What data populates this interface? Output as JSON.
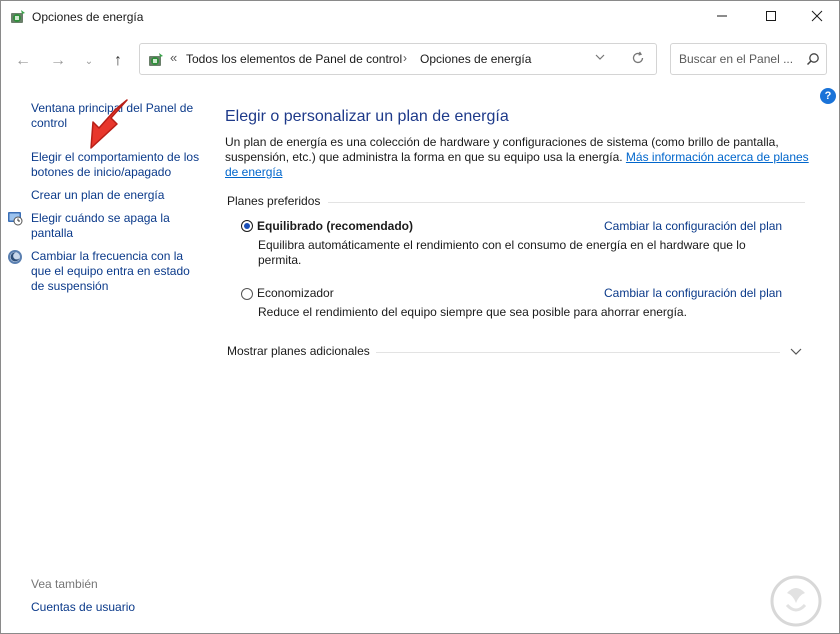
{
  "window": {
    "title": "Opciones de energía"
  },
  "nav": {
    "back_glyph": "←",
    "forward_glyph": "→",
    "recent_glyph": "⌄",
    "up_glyph": "↑"
  },
  "address": {
    "prefix": "«",
    "crumb1": "Todos los elementos de Panel de control",
    "chevron": "›",
    "crumb2": "Opciones de energía"
  },
  "search": {
    "placeholder": "Buscar en el Panel ..."
  },
  "sidebar": {
    "items": [
      {
        "label": "Ventana principal del Panel de control"
      },
      {
        "label": "Elegir el comportamiento de los botones de inicio/apagado"
      },
      {
        "label": "Crear un plan de energía"
      },
      {
        "label": "Elegir cuándo se apaga la pantalla"
      },
      {
        "label": "Cambiar la frecuencia con la que el equipo entra en estado de suspensión"
      }
    ],
    "see_also": "Vea también",
    "bottom_link": "Cuentas de usuario"
  },
  "main": {
    "title": "Elegir o personalizar un plan de energía",
    "intro": "Un plan de energía es una colección de hardware y configuraciones de sistema (como brillo de pantalla, suspensión, etc.) que administra la forma en que su equipo usa la energía.",
    "intro_link": "Más información acerca de planes de energía",
    "section_label": "Planes preferidos",
    "plans": [
      {
        "name": "Equilibrado (recomendado)",
        "selected": true,
        "link": "Cambiar la configuración del plan",
        "desc": "Equilibra automáticamente el rendimiento con el consumo de energía en el hardware que lo permita."
      },
      {
        "name": "Economizador",
        "selected": false,
        "link": "Cambiar la configuración del plan",
        "desc": "Reduce el rendimiento del equipo siempre que sea posible para ahorrar energía."
      }
    ],
    "more_plans": "Mostrar planes adicionales"
  },
  "help": {
    "label": "?"
  },
  "colors": {
    "link": "#0b3a8a",
    "title": "#1e3a8a",
    "accent": "#1a73d8",
    "arrow": "#e8372c"
  }
}
